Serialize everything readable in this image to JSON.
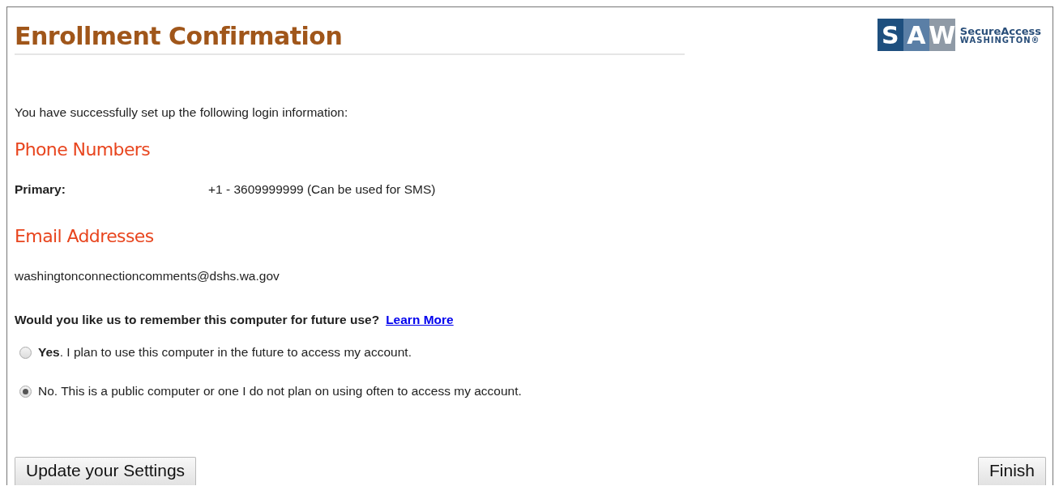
{
  "header": {
    "title": "Enrollment Confirmation",
    "logo": {
      "letters": [
        "S",
        "A",
        "W"
      ],
      "line_1": "SecureAccess",
      "line_2": "WASHINGTON®"
    }
  },
  "intro": "You have successfully set up the following login information:",
  "phone_section": {
    "heading": "Phone Numbers",
    "label": "Primary:",
    "value": "+1 - 3609999999 (Can be used for SMS)"
  },
  "email_section": {
    "heading": "Email Addresses",
    "value": "washingtonconnectioncomments@dshs.wa.gov"
  },
  "remember": {
    "question": "Would you like us to remember this computer for future use?",
    "link": "Learn More",
    "options": [
      {
        "label": "**Yes**. I plan to use this computer in the future to access my account.",
        "selected": false
      },
      {
        "label": "No. This is a public computer or one I do not plan on using often to access my account.",
        "selected": true
      }
    ]
  },
  "buttons": [
    "Update your Settings",
    "Finish"
  ]
}
